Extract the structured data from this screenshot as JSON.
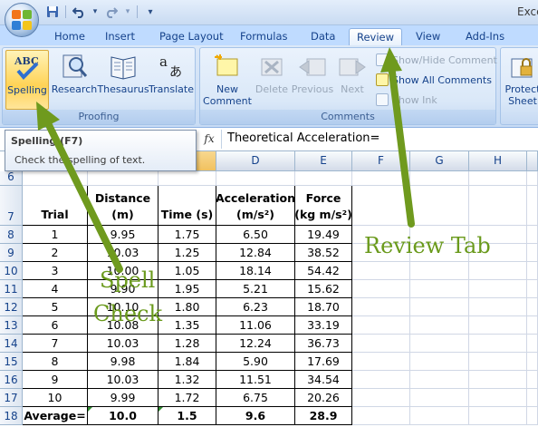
{
  "window": {
    "title": "Exce"
  },
  "quick_access": [
    {
      "name": "save-icon",
      "glyph": "💾"
    },
    {
      "name": "undo-icon",
      "glyph": "↶"
    },
    {
      "name": "undo-dropdown-icon",
      "glyph": "▾"
    },
    {
      "name": "redo-icon",
      "glyph": "↷"
    },
    {
      "name": "redo-dropdown-icon",
      "glyph": "▾"
    },
    {
      "name": "customize-qat-icon",
      "glyph": "≡"
    }
  ],
  "tabs": [
    {
      "label": "Home"
    },
    {
      "label": "Insert"
    },
    {
      "label": "Page Layout"
    },
    {
      "label": "Formulas"
    },
    {
      "label": "Data"
    },
    {
      "label": "Review",
      "active": true
    },
    {
      "label": "View"
    },
    {
      "label": "Add-Ins"
    }
  ],
  "ribbon": {
    "proofing": {
      "label": "Proofing",
      "spelling": "Spelling",
      "research": "Research",
      "thesaurus": "Thesaurus",
      "translate": "Translate"
    },
    "comments": {
      "label": "Comments",
      "new_comment_line1": "New",
      "new_comment_line2": "Comment",
      "delete": "Delete",
      "previous": "Previous",
      "next": "Next",
      "show_hide": "Show/Hide Comment",
      "show_all": "Show All Comments",
      "show_ink": "Show Ink"
    },
    "protect": {
      "line1": "Protect",
      "line2": "Sheet"
    }
  },
  "tooltip": {
    "title": "Spelling (F7)",
    "body": "Check the spelling of text."
  },
  "formula_bar": {
    "fx": "fx",
    "value": "Theoretical Acceleration="
  },
  "columns": [
    "D",
    "E",
    "F",
    "G",
    "H"
  ],
  "table": {
    "headers": {
      "trial": "Trial",
      "distance_1": "Distance",
      "distance_2": "(m)",
      "time": "Time (s)",
      "accel_1": "Acceleration",
      "accel_2": "(m/s²)",
      "force_1": "Force",
      "force_2": "(kg m/s²)"
    },
    "rows": [
      {
        "row": "8",
        "trial": "1",
        "distance": "9.95",
        "time": "1.75",
        "accel": "6.50",
        "force": "19.49"
      },
      {
        "row": "9",
        "trial": "2",
        "distance": "10.03",
        "time": "1.25",
        "accel": "12.84",
        "force": "38.52"
      },
      {
        "row": "10",
        "trial": "3",
        "distance": "10.00",
        "time": "1.05",
        "accel": "18.14",
        "force": "54.42"
      },
      {
        "row": "11",
        "trial": "4",
        "distance": "9.90",
        "time": "1.95",
        "accel": "5.21",
        "force": "15.62"
      },
      {
        "row": "12",
        "trial": "5",
        "distance": "10.10",
        "time": "1.80",
        "accel": "6.23",
        "force": "18.70"
      },
      {
        "row": "13",
        "trial": "6",
        "distance": "10.08",
        "time": "1.35",
        "accel": "11.06",
        "force": "33.19"
      },
      {
        "row": "14",
        "trial": "7",
        "distance": "10.03",
        "time": "1.28",
        "accel": "12.24",
        "force": "36.73"
      },
      {
        "row": "15",
        "trial": "8",
        "distance": "9.98",
        "time": "1.84",
        "accel": "5.90",
        "force": "17.69"
      },
      {
        "row": "16",
        "trial": "9",
        "distance": "10.03",
        "time": "1.32",
        "accel": "11.51",
        "force": "34.54"
      },
      {
        "row": "17",
        "trial": "10",
        "distance": "9.99",
        "time": "1.72",
        "accel": "6.75",
        "force": "20.26"
      }
    ],
    "average": {
      "row": "18",
      "label": "Average=",
      "distance": "10.0",
      "time": "1.5",
      "accel": "9.6",
      "force": "28.9"
    },
    "row6": "6",
    "row7": "7"
  },
  "annotations": {
    "review_tab": "Review Tab",
    "spell_line1": "Spell",
    "spell_line2": "Check"
  },
  "colors": {
    "annotation_green": "#6a9a1c",
    "arrow_green": "#6f9a1e",
    "ribbon_text": "#15428b"
  }
}
